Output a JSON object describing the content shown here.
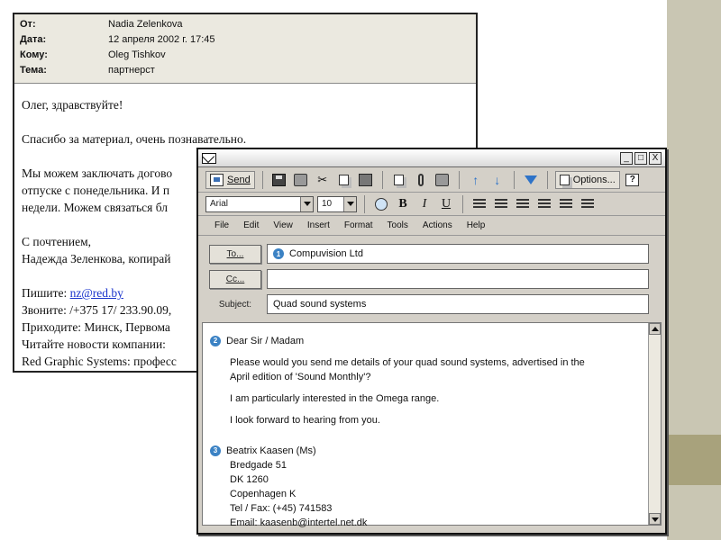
{
  "letter": {
    "header": [
      {
        "label": "От:",
        "value": "Nadia Zelenkova"
      },
      {
        "label": "Дата:",
        "value": "12 апреля 2002 г. 17:45"
      },
      {
        "label": "Кому:",
        "value": "Oleg Tishkov"
      },
      {
        "label": "Тема:",
        "value": "партнерст"
      }
    ],
    "greeting": "Олег, здравствуйте!",
    "thanks": "Спасибо за материал, очень познавательно.",
    "para": [
      "Мы можем заключать догово",
      "отпуске с понедельника. И п",
      "недели. Можем связаться бл"
    ],
    "signoff": "С почтением,",
    "signature": "Надежда Зеленкова, копирай",
    "write_prefix": "Пишите: ",
    "email_link": "nz@red.by",
    "call": "Звоните: /+375 17/ 233.90.09,",
    "visit": "Приходите: Минск, Первома",
    "news": "Читайте новости компании:",
    "tagline": "Red Graphic Systems: професс"
  },
  "compose": {
    "window_buttons": [
      "_",
      "□",
      "X"
    ],
    "toolbar": {
      "send": "Send",
      "options": "Options..."
    },
    "format": {
      "font": "Arial",
      "size": "10",
      "bold": "B",
      "italic": "I",
      "underline": "U"
    },
    "menu": [
      "File",
      "Edit",
      "View",
      "Insert",
      "Format",
      "Tools",
      "Actions",
      "Help"
    ],
    "to_label": "To...",
    "cc_label": "Cc...",
    "subject_label": "Subject:",
    "to_value": "Compuvision Ltd",
    "cc_value": "",
    "subject_value": "Quad sound systems",
    "markers": [
      "1",
      "2",
      "3"
    ],
    "body": {
      "salutation": "Dear Sir / Madam",
      "p1a": "Please would you send me details of your quad sound systems, advertised in the",
      "p1b": "April edition of 'Sound Monthly'?",
      "p2": "I am particularly interested in the Omega range.",
      "p3": "I look forward to hearing from you.",
      "name": "Beatrix Kaasen (Ms)",
      "addr1": "Bredgade 51",
      "addr2": "DK 1260",
      "addr3": "Copenhagen K",
      "tel": "Tel / Fax: (+45) 741583",
      "email": "Email: kaasenb@intertel.net.dk"
    }
  }
}
